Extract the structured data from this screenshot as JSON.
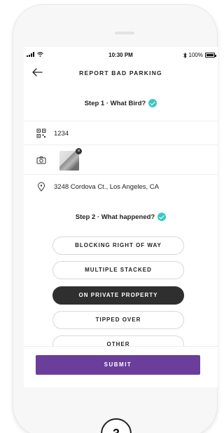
{
  "status_bar": {
    "time": "10:30 PM",
    "battery": "100%",
    "icons": [
      "signal-icon",
      "wifi-icon",
      "bluetooth-icon",
      "battery-icon"
    ]
  },
  "nav": {
    "title": "REPORT BAD PARKING",
    "back_icon": "back-arrow-icon"
  },
  "step1": {
    "label": "Step 1 · What Bird?",
    "bird_id": "1234",
    "address": "3248 Cordova Ct., Los Angeles, CA"
  },
  "step2": {
    "label": "Step 2 · What happened?",
    "options": [
      {
        "label": "BLOCKING RIGHT OF WAY",
        "selected": false
      },
      {
        "label": "MULTIPLE STACKED",
        "selected": false
      },
      {
        "label": "ON PRIVATE PROPERTY",
        "selected": true
      },
      {
        "label": "TIPPED OVER",
        "selected": false
      },
      {
        "label": "OTHER",
        "selected": false
      }
    ]
  },
  "submit_label": "SUBMIT",
  "page_badge": "3",
  "colors": {
    "accent": "#6b3e9b",
    "check": "#3cc7c2",
    "selected_option": "#2f2f2f"
  }
}
